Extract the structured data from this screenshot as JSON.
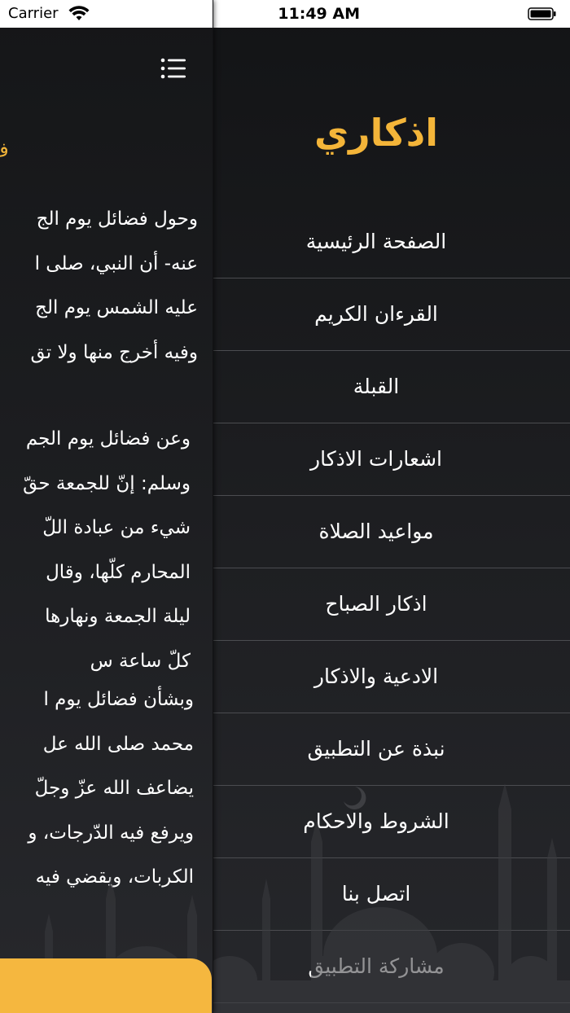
{
  "status_bar": {
    "carrier": "Carrier",
    "time": "11:49 AM"
  },
  "colors": {
    "accent": "#f4b539",
    "button": "#f5b73f",
    "background": "#1f2023",
    "divider": "#4b4c50"
  },
  "menu": {
    "title": "اذكاري",
    "items": [
      {
        "label": "الصفحة الرئيسية"
      },
      {
        "label": "القرءان الكريم"
      },
      {
        "label": "القبلة"
      },
      {
        "label": "اشعارات الاذكار"
      },
      {
        "label": "مواعيد الصلاة"
      },
      {
        "label": "اذكار الصباح"
      },
      {
        "label": "الادعية والاذكار"
      },
      {
        "label": "نبذة عن التطبيق"
      },
      {
        "label": "الشروط والاحكام"
      },
      {
        "label": "اتصل بنا"
      },
      {
        "label": "مشاركة التطبيق"
      }
    ]
  },
  "content": {
    "heading": "ف",
    "paragraph1": [
      "وحول فضائل يوم الج",
      "عنه- أن النبي، صلى ا",
      "عليه الشمس يوم الج",
      "وفيه أخرج منها ولا تق"
    ],
    "paragraph2": [
      "وعن فضائل يوم الجم",
      "وسلم: إنّ للجمعة حقّ",
      "شيء من عبادة اللّ",
      "المحارم كلّها، وقال",
      "ليلة الجمعة ونهارها",
      "كلّ ساعة س"
    ],
    "paragraph3": [
      "وبشأن فضائل يوم ا",
      "محمد صلى الله عل",
      "يضاعف الله عزّ وجلّ",
      "ويرفع فيه الدّرجات، و",
      "الكربات، ويقضي فيه"
    ]
  },
  "icons": {
    "menu": "hamburger-list-icon",
    "wifi": "wifi-icon",
    "battery": "battery-icon"
  }
}
